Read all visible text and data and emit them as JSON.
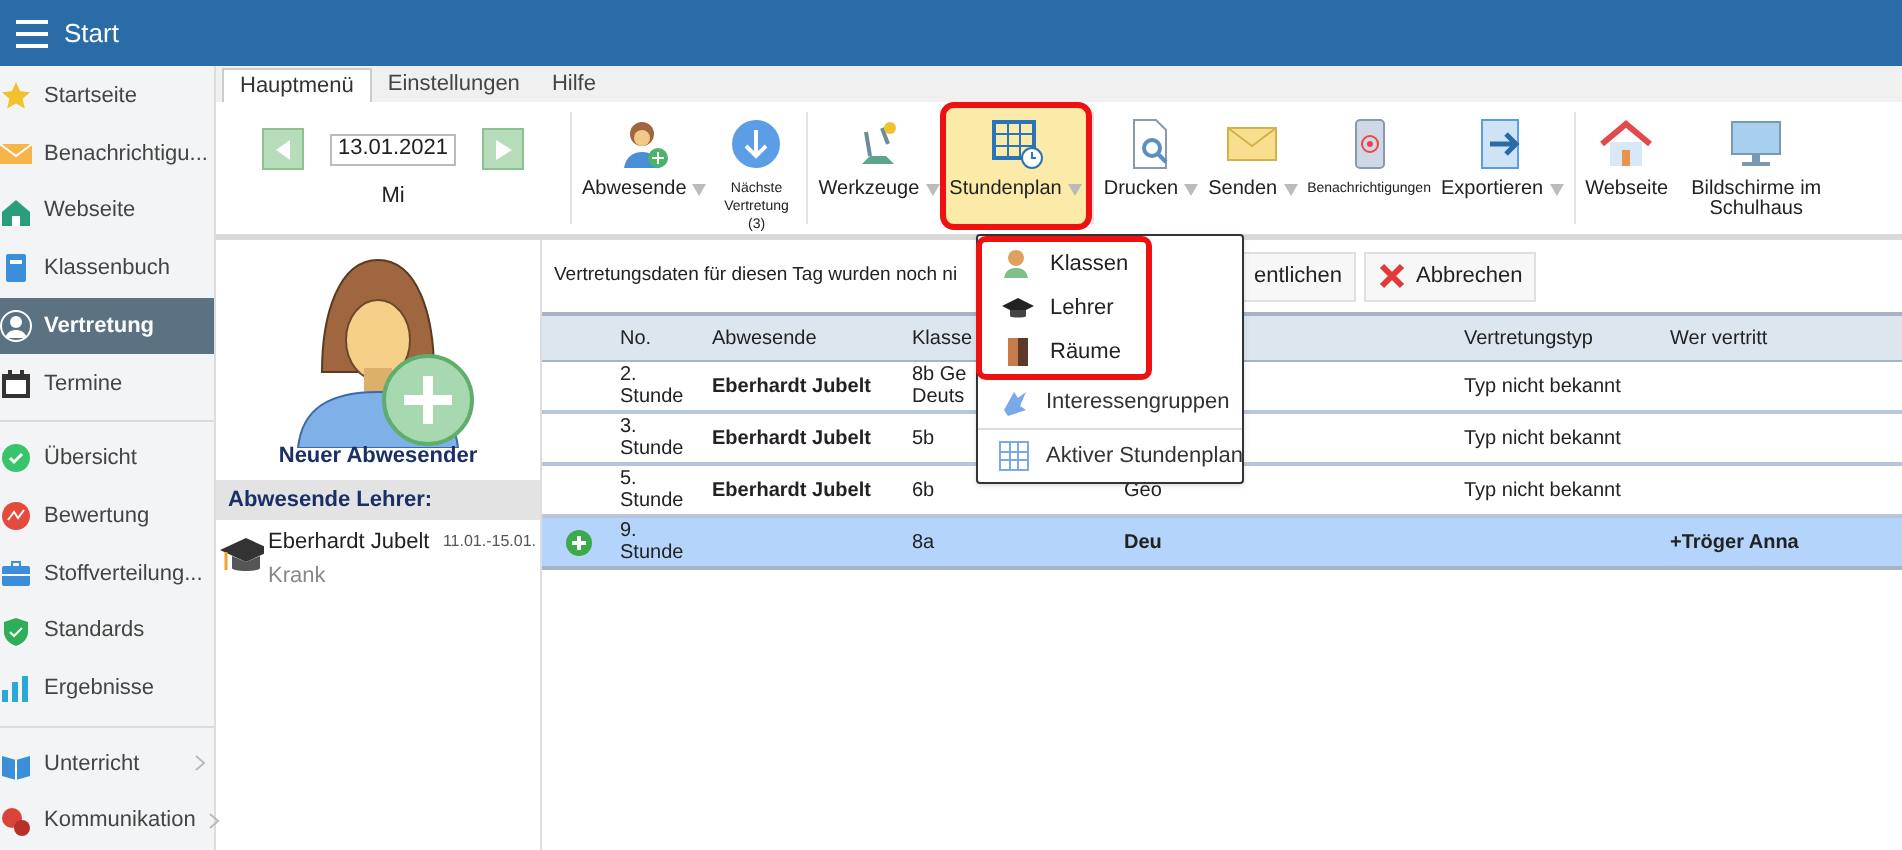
{
  "app_bar": {
    "title": "Start"
  },
  "sidebar": {
    "groups": [
      [
        {
          "label": "Startseite",
          "selected": false
        },
        {
          "label": "Benachrichtigu...",
          "selected": false
        },
        {
          "label": "Webseite",
          "selected": false
        },
        {
          "label": "Klassenbuch",
          "selected": false
        },
        {
          "label": "Vertretung",
          "selected": true
        },
        {
          "label": "Termine",
          "selected": false
        }
      ],
      [
        {
          "label": "Übersicht",
          "selected": false
        },
        {
          "label": "Bewertung",
          "selected": false
        },
        {
          "label": "Stoffverteilung...",
          "selected": false
        },
        {
          "label": "Standards",
          "selected": false
        },
        {
          "label": "Ergebnisse",
          "selected": false
        }
      ],
      [
        {
          "label": "Unterricht",
          "selected": false,
          "submenu": true
        },
        {
          "label": "Kommunikation",
          "selected": false,
          "submenu": true
        }
      ]
    ]
  },
  "ribbon": {
    "tabs": [
      {
        "label": "Hauptmenü",
        "selected": true
      },
      {
        "label": "Einstellungen",
        "selected": false
      },
      {
        "label": "Hilfe",
        "selected": false
      }
    ],
    "date": "13.01.2021",
    "weekday": "Mi",
    "groups": [
      [
        {
          "label": "Abwesende",
          "kind": "large",
          "dropdown": true,
          "selected": false,
          "highlighted": false
        },
        {
          "label": "Nächste Vertretung (3)",
          "kind": "small",
          "dropdown": false,
          "selected": false,
          "highlighted": false
        }
      ],
      [
        {
          "label": "Werkzeuge",
          "kind": "large",
          "dropdown": true,
          "selected": false,
          "highlighted": false
        },
        {
          "label": "Stundenplan",
          "kind": "large",
          "dropdown": true,
          "selected": true,
          "highlighted": true
        }
      ],
      [
        {
          "label": "Drucken",
          "kind": "large",
          "dropdown": true,
          "selected": false,
          "highlighted": false
        },
        {
          "label": "Senden",
          "kind": "large",
          "dropdown": true,
          "selected": false,
          "highlighted": false
        },
        {
          "label": "Benachrichtigungen",
          "kind": "small",
          "dropdown": false,
          "selected": false,
          "highlighted": false
        },
        {
          "label": "Exportieren",
          "kind": "large",
          "dropdown": true,
          "selected": false,
          "highlighted": false
        }
      ],
      [
        {
          "label": "Webseite",
          "kind": "large",
          "dropdown": false,
          "selected": false,
          "highlighted": false
        },
        {
          "label": "Bildschirme im Schulhaus",
          "kind": "large",
          "dropdown": false,
          "selected": false,
          "highlighted": false
        }
      ]
    ]
  },
  "stundenplan_menu": {
    "items": [
      {
        "label": "Klassen",
        "highlighted": true
      },
      {
        "label": "Lehrer",
        "highlighted": true
      },
      {
        "label": "Räume",
        "highlighted": true
      },
      {
        "label": "Interessengruppen",
        "highlighted": false
      },
      {
        "label": "Aktiver Stundenplan",
        "highlighted": false
      }
    ]
  },
  "absent_panel": {
    "new_label": "Neuer Abwesender",
    "heading": "Abwesende Lehrer:",
    "teachers": [
      {
        "name": "Eberhardt Jubelt",
        "dates": "11.01.-15.01.",
        "reason": "Krank"
      }
    ]
  },
  "substitutions": {
    "message": "Vertretungsdaten für diesen Tag wurden noch ni",
    "buttons": [
      {
        "label": "entlichen",
        "kind": "plain"
      },
      {
        "label": "Abbrechen",
        "kind": "cancel"
      }
    ],
    "columns": [
      "No.",
      "Abwesende",
      "Klasse",
      "",
      "Vertretungstyp",
      "Wer vertritt"
    ],
    "rows": [
      {
        "no": "2. Stunde",
        "absent": "Eberhardt Jubelt",
        "klasse": "8b Ge Deuts",
        "subject": "",
        "type": "Typ nicht bekannt",
        "substitute": "",
        "selected": false,
        "added": false
      },
      {
        "no": "3. Stunde",
        "absent": "Eberhardt Jubelt",
        "klasse": "5b",
        "subject": "",
        "type": "Typ nicht bekannt",
        "substitute": "",
        "selected": false,
        "added": false
      },
      {
        "no": "5. Stunde",
        "absent": "Eberhardt Jubelt",
        "klasse": "6b",
        "subject": "Geo",
        "type": "Typ nicht bekannt",
        "substitute": "",
        "selected": false,
        "added": false
      },
      {
        "no": "9. Stunde",
        "absent": "",
        "klasse": "8a",
        "subject": "Deu",
        "type": "",
        "substitute": "+Tröger Anna",
        "selected": true,
        "added": true
      }
    ]
  }
}
